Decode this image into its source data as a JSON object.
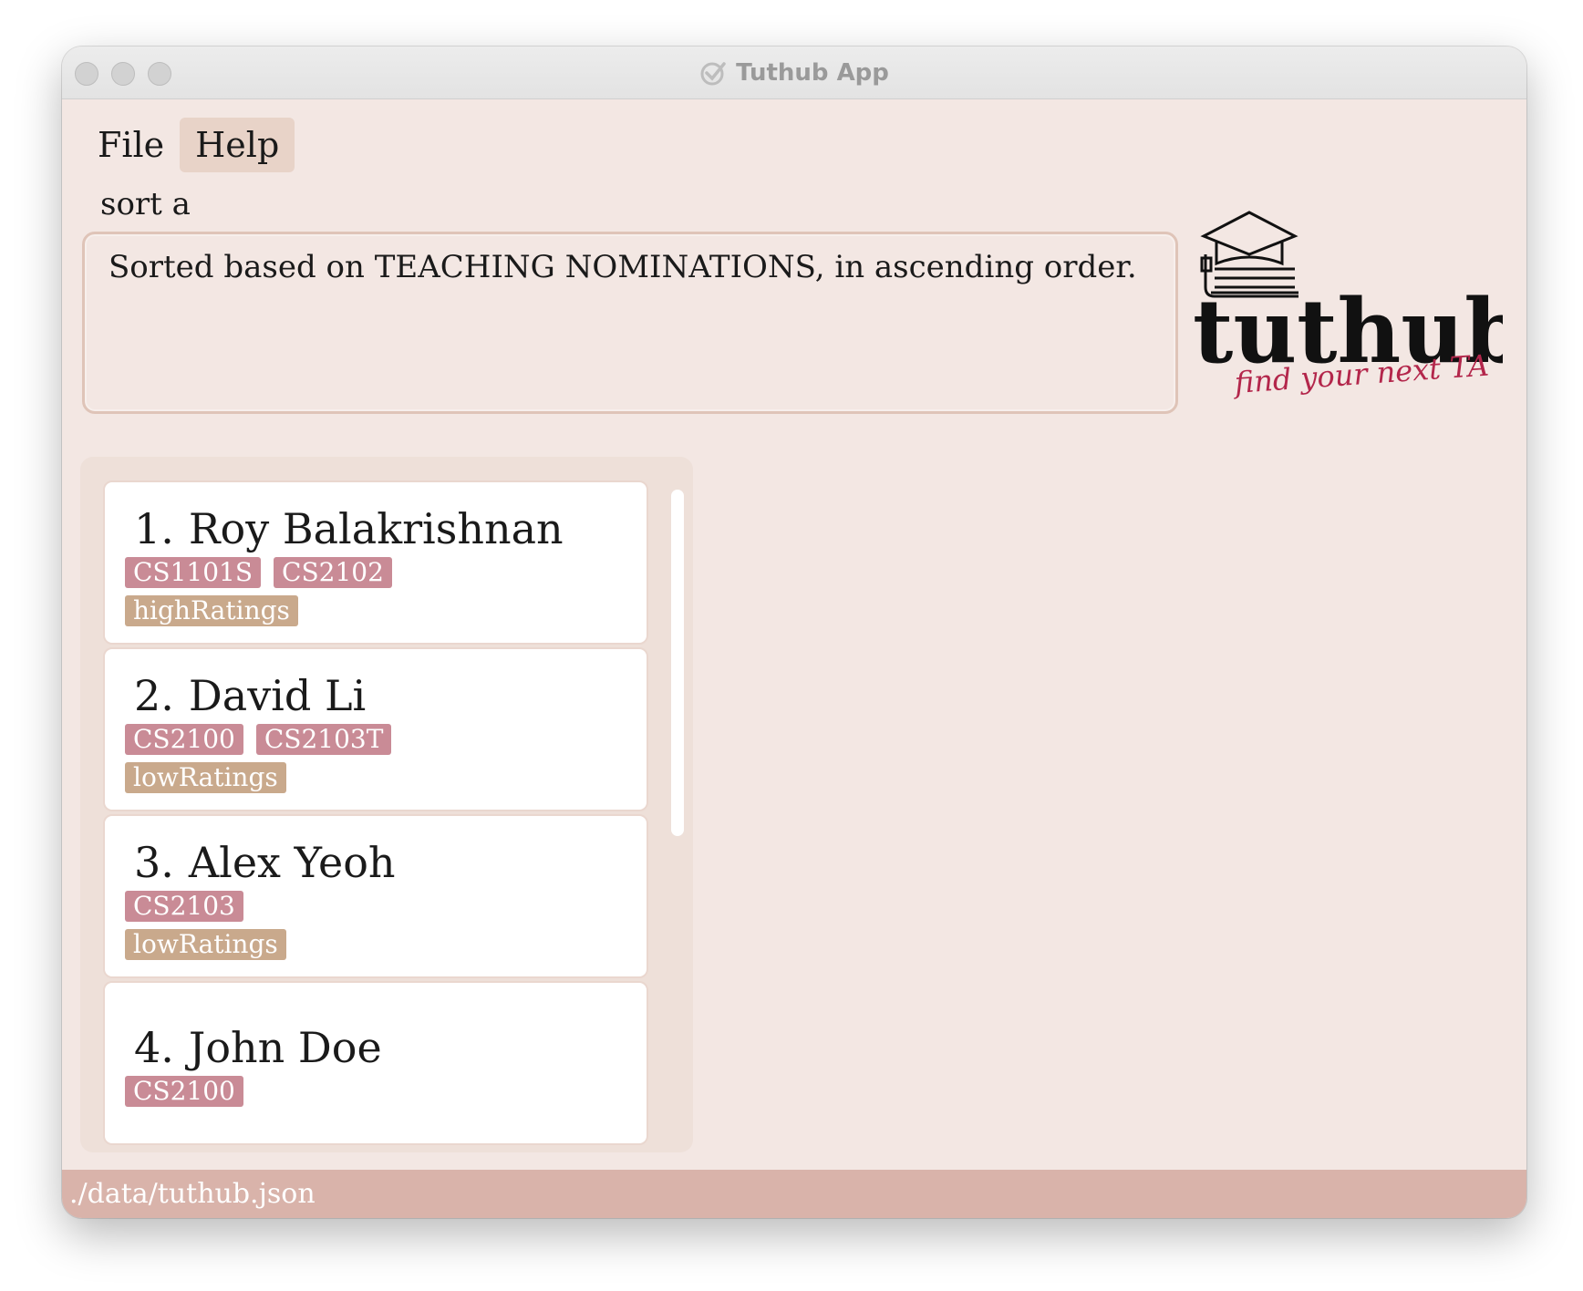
{
  "window": {
    "title": "Tuthub App"
  },
  "menu": {
    "items": [
      "File",
      "Help"
    ]
  },
  "command": {
    "value": "sort a"
  },
  "result": {
    "text": "Sorted based on TEACHING NOMINATIONS, in ascending order."
  },
  "logo": {
    "wordmark": "tuthub.",
    "tagline": "find your next TA"
  },
  "tutors": [
    {
      "index": "1.",
      "name": "Roy Balakrishnan",
      "modules": [
        "CS1101S",
        "CS2102"
      ],
      "ratings": [
        "highRatings"
      ]
    },
    {
      "index": "2.",
      "name": "David Li",
      "modules": [
        "CS2100",
        "CS2103T"
      ],
      "ratings": [
        "lowRatings"
      ]
    },
    {
      "index": "3.",
      "name": "Alex Yeoh",
      "modules": [
        "CS2103"
      ],
      "ratings": [
        "lowRatings"
      ]
    },
    {
      "index": "4.",
      "name": "John Doe",
      "modules": [
        "CS2100"
      ],
      "ratings": []
    }
  ],
  "status": {
    "path": "./data/tuthub.json"
  },
  "colors": {
    "module_tag": "#c98b96",
    "rating_tag": "#c9a98c",
    "statusbar": "#d9b3aa",
    "window_bg": "#f3e7e3"
  }
}
